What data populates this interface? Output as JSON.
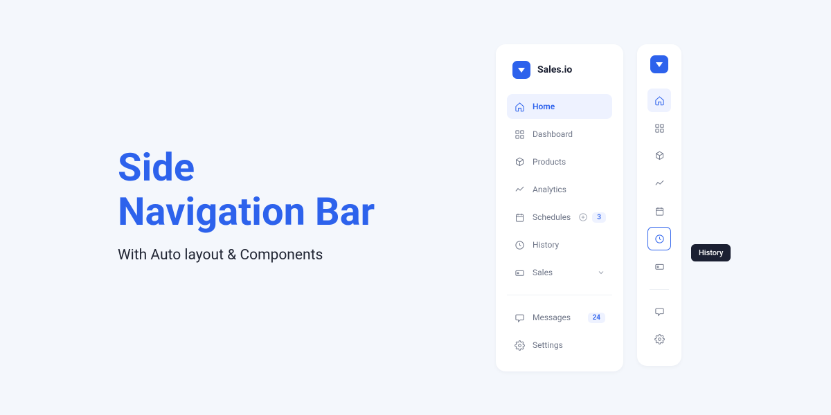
{
  "hero": {
    "title_line1": "Side",
    "title_line2": "Navigation Bar",
    "subtitle": "With Auto layout & Components"
  },
  "brand": "Sales.io",
  "nav": {
    "home": "Home",
    "dashboard": "Dashboard",
    "products": "Products",
    "analytics": "Analytics",
    "schedules": "Schedules",
    "schedules_badge": "3",
    "history": "History",
    "sales": "Sales",
    "messages": "Messages",
    "messages_badge": "24",
    "settings": "Settings"
  },
  "tooltip": "History",
  "colors": {
    "primary": "#2d62ec",
    "primary_soft": "#eef2ff",
    "text_muted": "#6f7688"
  }
}
